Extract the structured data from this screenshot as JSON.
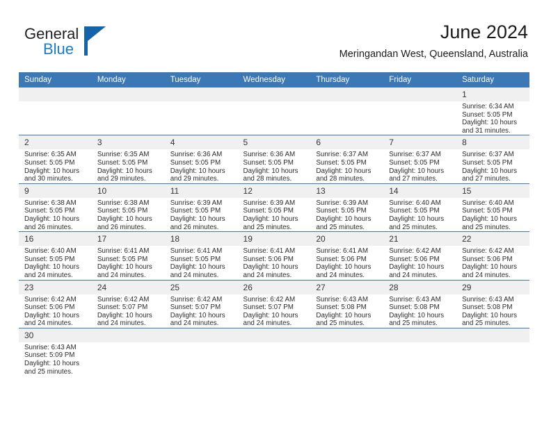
{
  "brand": {
    "name_part1": "General",
    "name_part2": "Blue",
    "color_dark": "#231f20",
    "color_blue": "#1a7dc4",
    "triangle_color": "#1464aa"
  },
  "header": {
    "title": "June 2024",
    "subtitle": "Meringandan West, Queensland, Australia"
  },
  "theme": {
    "header_blue": "#3b78b5",
    "daynum_band": "#f0f0f0",
    "grid_line": "#3b78b5"
  },
  "labels": {
    "sunrise_prefix": "Sunrise:",
    "sunset_prefix": "Sunset:",
    "daylight_prefix": "Daylight:"
  },
  "weekday_headers": [
    "Sunday",
    "Monday",
    "Tuesday",
    "Wednesday",
    "Thursday",
    "Friday",
    "Saturday"
  ],
  "weeks": [
    [
      {
        "day": "",
        "sunrise": "",
        "sunset": "",
        "daylight_line1": "",
        "daylight_line2": ""
      },
      {
        "day": "",
        "sunrise": "",
        "sunset": "",
        "daylight_line1": "",
        "daylight_line2": ""
      },
      {
        "day": "",
        "sunrise": "",
        "sunset": "",
        "daylight_line1": "",
        "daylight_line2": ""
      },
      {
        "day": "",
        "sunrise": "",
        "sunset": "",
        "daylight_line1": "",
        "daylight_line2": ""
      },
      {
        "day": "",
        "sunrise": "",
        "sunset": "",
        "daylight_line1": "",
        "daylight_line2": ""
      },
      {
        "day": "",
        "sunrise": "",
        "sunset": "",
        "daylight_line1": "",
        "daylight_line2": ""
      },
      {
        "day": "1",
        "sunrise": "Sunrise: 6:34 AM",
        "sunset": "Sunset: 5:05 PM",
        "daylight_line1": "Daylight: 10 hours",
        "daylight_line2": "and 31 minutes."
      }
    ],
    [
      {
        "day": "2",
        "sunrise": "Sunrise: 6:35 AM",
        "sunset": "Sunset: 5:05 PM",
        "daylight_line1": "Daylight: 10 hours",
        "daylight_line2": "and 30 minutes."
      },
      {
        "day": "3",
        "sunrise": "Sunrise: 6:35 AM",
        "sunset": "Sunset: 5:05 PM",
        "daylight_line1": "Daylight: 10 hours",
        "daylight_line2": "and 29 minutes."
      },
      {
        "day": "4",
        "sunrise": "Sunrise: 6:36 AM",
        "sunset": "Sunset: 5:05 PM",
        "daylight_line1": "Daylight: 10 hours",
        "daylight_line2": "and 29 minutes."
      },
      {
        "day": "5",
        "sunrise": "Sunrise: 6:36 AM",
        "sunset": "Sunset: 5:05 PM",
        "daylight_line1": "Daylight: 10 hours",
        "daylight_line2": "and 28 minutes."
      },
      {
        "day": "6",
        "sunrise": "Sunrise: 6:37 AM",
        "sunset": "Sunset: 5:05 PM",
        "daylight_line1": "Daylight: 10 hours",
        "daylight_line2": "and 28 minutes."
      },
      {
        "day": "7",
        "sunrise": "Sunrise: 6:37 AM",
        "sunset": "Sunset: 5:05 PM",
        "daylight_line1": "Daylight: 10 hours",
        "daylight_line2": "and 27 minutes."
      },
      {
        "day": "8",
        "sunrise": "Sunrise: 6:37 AM",
        "sunset": "Sunset: 5:05 PM",
        "daylight_line1": "Daylight: 10 hours",
        "daylight_line2": "and 27 minutes."
      }
    ],
    [
      {
        "day": "9",
        "sunrise": "Sunrise: 6:38 AM",
        "sunset": "Sunset: 5:05 PM",
        "daylight_line1": "Daylight: 10 hours",
        "daylight_line2": "and 26 minutes."
      },
      {
        "day": "10",
        "sunrise": "Sunrise: 6:38 AM",
        "sunset": "Sunset: 5:05 PM",
        "daylight_line1": "Daylight: 10 hours",
        "daylight_line2": "and 26 minutes."
      },
      {
        "day": "11",
        "sunrise": "Sunrise: 6:39 AM",
        "sunset": "Sunset: 5:05 PM",
        "daylight_line1": "Daylight: 10 hours",
        "daylight_line2": "and 26 minutes."
      },
      {
        "day": "12",
        "sunrise": "Sunrise: 6:39 AM",
        "sunset": "Sunset: 5:05 PM",
        "daylight_line1": "Daylight: 10 hours",
        "daylight_line2": "and 25 minutes."
      },
      {
        "day": "13",
        "sunrise": "Sunrise: 6:39 AM",
        "sunset": "Sunset: 5:05 PM",
        "daylight_line1": "Daylight: 10 hours",
        "daylight_line2": "and 25 minutes."
      },
      {
        "day": "14",
        "sunrise": "Sunrise: 6:40 AM",
        "sunset": "Sunset: 5:05 PM",
        "daylight_line1": "Daylight: 10 hours",
        "daylight_line2": "and 25 minutes."
      },
      {
        "day": "15",
        "sunrise": "Sunrise: 6:40 AM",
        "sunset": "Sunset: 5:05 PM",
        "daylight_line1": "Daylight: 10 hours",
        "daylight_line2": "and 25 minutes."
      }
    ],
    [
      {
        "day": "16",
        "sunrise": "Sunrise: 6:40 AM",
        "sunset": "Sunset: 5:05 PM",
        "daylight_line1": "Daylight: 10 hours",
        "daylight_line2": "and 24 minutes."
      },
      {
        "day": "17",
        "sunrise": "Sunrise: 6:41 AM",
        "sunset": "Sunset: 5:05 PM",
        "daylight_line1": "Daylight: 10 hours",
        "daylight_line2": "and 24 minutes."
      },
      {
        "day": "18",
        "sunrise": "Sunrise: 6:41 AM",
        "sunset": "Sunset: 5:05 PM",
        "daylight_line1": "Daylight: 10 hours",
        "daylight_line2": "and 24 minutes."
      },
      {
        "day": "19",
        "sunrise": "Sunrise: 6:41 AM",
        "sunset": "Sunset: 5:06 PM",
        "daylight_line1": "Daylight: 10 hours",
        "daylight_line2": "and 24 minutes."
      },
      {
        "day": "20",
        "sunrise": "Sunrise: 6:41 AM",
        "sunset": "Sunset: 5:06 PM",
        "daylight_line1": "Daylight: 10 hours",
        "daylight_line2": "and 24 minutes."
      },
      {
        "day": "21",
        "sunrise": "Sunrise: 6:42 AM",
        "sunset": "Sunset: 5:06 PM",
        "daylight_line1": "Daylight: 10 hours",
        "daylight_line2": "and 24 minutes."
      },
      {
        "day": "22",
        "sunrise": "Sunrise: 6:42 AM",
        "sunset": "Sunset: 5:06 PM",
        "daylight_line1": "Daylight: 10 hours",
        "daylight_line2": "and 24 minutes."
      }
    ],
    [
      {
        "day": "23",
        "sunrise": "Sunrise: 6:42 AM",
        "sunset": "Sunset: 5:06 PM",
        "daylight_line1": "Daylight: 10 hours",
        "daylight_line2": "and 24 minutes."
      },
      {
        "day": "24",
        "sunrise": "Sunrise: 6:42 AM",
        "sunset": "Sunset: 5:07 PM",
        "daylight_line1": "Daylight: 10 hours",
        "daylight_line2": "and 24 minutes."
      },
      {
        "day": "25",
        "sunrise": "Sunrise: 6:42 AM",
        "sunset": "Sunset: 5:07 PM",
        "daylight_line1": "Daylight: 10 hours",
        "daylight_line2": "and 24 minutes."
      },
      {
        "day": "26",
        "sunrise": "Sunrise: 6:42 AM",
        "sunset": "Sunset: 5:07 PM",
        "daylight_line1": "Daylight: 10 hours",
        "daylight_line2": "and 24 minutes."
      },
      {
        "day": "27",
        "sunrise": "Sunrise: 6:43 AM",
        "sunset": "Sunset: 5:08 PM",
        "daylight_line1": "Daylight: 10 hours",
        "daylight_line2": "and 25 minutes."
      },
      {
        "day": "28",
        "sunrise": "Sunrise: 6:43 AM",
        "sunset": "Sunset: 5:08 PM",
        "daylight_line1": "Daylight: 10 hours",
        "daylight_line2": "and 25 minutes."
      },
      {
        "day": "29",
        "sunrise": "Sunrise: 6:43 AM",
        "sunset": "Sunset: 5:08 PM",
        "daylight_line1": "Daylight: 10 hours",
        "daylight_line2": "and 25 minutes."
      }
    ],
    [
      {
        "day": "30",
        "sunrise": "Sunrise: 6:43 AM",
        "sunset": "Sunset: 5:09 PM",
        "daylight_line1": "Daylight: 10 hours",
        "daylight_line2": "and 25 minutes."
      },
      {
        "day": "",
        "sunrise": "",
        "sunset": "",
        "daylight_line1": "",
        "daylight_line2": ""
      },
      {
        "day": "",
        "sunrise": "",
        "sunset": "",
        "daylight_line1": "",
        "daylight_line2": ""
      },
      {
        "day": "",
        "sunrise": "",
        "sunset": "",
        "daylight_line1": "",
        "daylight_line2": ""
      },
      {
        "day": "",
        "sunrise": "",
        "sunset": "",
        "daylight_line1": "",
        "daylight_line2": ""
      },
      {
        "day": "",
        "sunrise": "",
        "sunset": "",
        "daylight_line1": "",
        "daylight_line2": ""
      },
      {
        "day": "",
        "sunrise": "",
        "sunset": "",
        "daylight_line1": "",
        "daylight_line2": ""
      }
    ]
  ]
}
